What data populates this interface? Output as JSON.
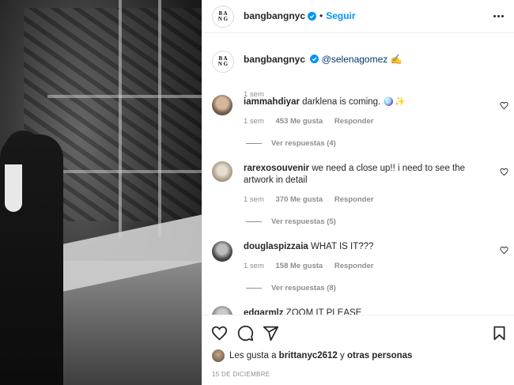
{
  "post": {
    "account": "bangbangnyc",
    "logo_text": "B A\nN G",
    "follow_label": "Seguir",
    "separator": "•",
    "caption_mention": "@selenagomez",
    "caption_emoji": "✍️",
    "caption_time": "1 sem"
  },
  "comments": [
    {
      "user": "iammahdiyar",
      "text": "darklena is coming. 🪩✨",
      "time": "1 sem",
      "likes": "453 Me gusta",
      "reply": "Responder",
      "view_replies": "Ver respuestas (4)"
    },
    {
      "user": "rarexosouvenir",
      "text": "we need a close up!! i need to see the artwork in detail",
      "time": "1 sem",
      "likes": "370 Me gusta",
      "reply": "Responder",
      "view_replies": "Ver respuestas (5)"
    },
    {
      "user": "douglaspizzaia",
      "text": "WHAT IS IT???",
      "time": "1 sem",
      "likes": "158 Me gusta",
      "reply": "Responder",
      "view_replies": "Ver respuestas (8)"
    },
    {
      "user": "edgarmlz",
      "text": "ZOOM IT PLEASE"
    }
  ],
  "footer": {
    "likes_prefix": "Les gusta a",
    "likes_user": "brittanyc2612",
    "likes_conj": "y",
    "likes_others": "otras personas",
    "date": "15 DE DICIEMBRE"
  },
  "icons": {
    "like": "heart-icon",
    "comment": "comment-icon",
    "share": "send-icon",
    "save": "bookmark-icon",
    "more": "more-icon",
    "verified": "verified-badge-icon"
  },
  "colors": {
    "link": "#0095f6",
    "mention": "#00376b",
    "muted": "#8e8e8e",
    "text": "#262626"
  }
}
